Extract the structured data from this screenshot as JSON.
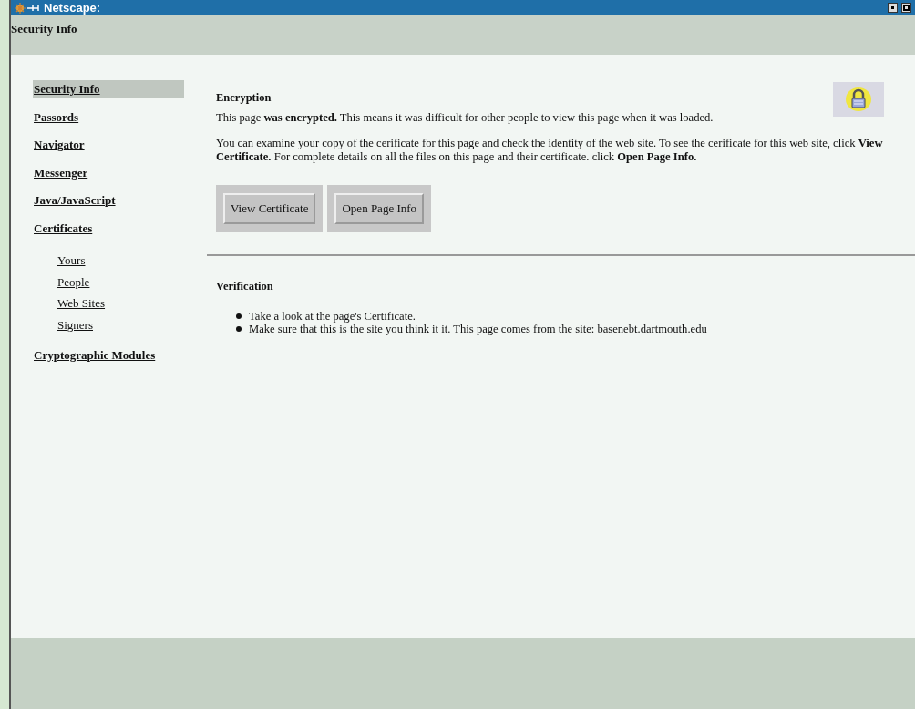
{
  "window": {
    "title": "Netscape:"
  },
  "header": {
    "title": "Security Info"
  },
  "sidebar": {
    "items": [
      {
        "label": "Security Info",
        "selected": true
      },
      {
        "label": "Passords",
        "selected": false
      },
      {
        "label": "Navigator",
        "selected": false
      },
      {
        "label": "Messenger",
        "selected": false
      },
      {
        "label": "Java/JavaScript",
        "selected": false
      },
      {
        "label": "Certificates",
        "selected": false,
        "children": [
          {
            "label": "Yours",
            "selected": false
          },
          {
            "label": "People",
            "selected": false
          },
          {
            "label": "Web Sites",
            "selected": false
          },
          {
            "label": "Signers",
            "selected": false
          }
        ]
      },
      {
        "label": "Cryptographic Modules",
        "selected": false
      }
    ]
  },
  "encryption": {
    "heading": "Encryption",
    "paragraphs": [
      "This page **was encrypted.** This means it was difficult for other people to view this page when it was loaded.",
      "You can examine your copy of the cerificate for this page and check the identity of the web site. To see the cerificate for this web site, click **View Certificate.** For complete details on all the files on this page and their certificate. click **Open Page Info.**"
    ],
    "buttons": [
      "View Certificate",
      "Open Page Info"
    ]
  },
  "verification": {
    "heading": "Verification",
    "bullets": [
      "Take a look at the page's Certificate.",
      "Make sure that this is the site you think it it. This page comes from the site: basenebt.dartmouth.edu"
    ]
  }
}
